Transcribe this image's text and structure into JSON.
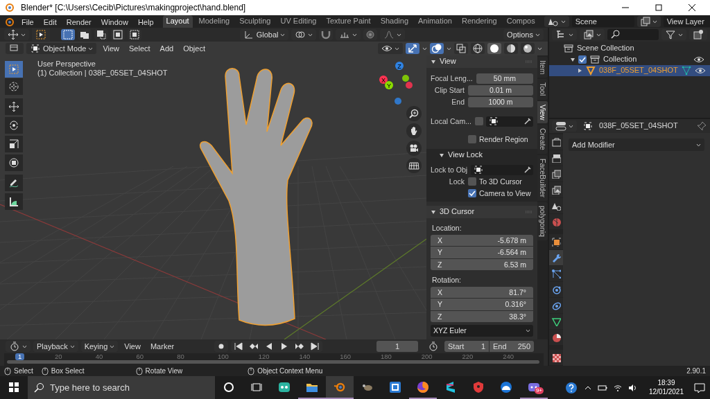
{
  "window": {
    "title": "Blender* [C:\\Users\\Cecib\\Pictures\\makingproject\\hand.blend]"
  },
  "menu": [
    "File",
    "Edit",
    "Render",
    "Window",
    "Help"
  ],
  "workspaces": [
    {
      "label": "Layout",
      "selected": true
    },
    {
      "label": "Modeling",
      "selected": false
    },
    {
      "label": "Sculpting",
      "selected": false
    },
    {
      "label": "UV Editing",
      "selected": false
    },
    {
      "label": "Texture Paint",
      "selected": false
    },
    {
      "label": "Shading",
      "selected": false
    },
    {
      "label": "Animation",
      "selected": false
    },
    {
      "label": "Rendering",
      "selected": false
    },
    {
      "label": "Compos",
      "selected": false
    }
  ],
  "scene": "Scene",
  "view_layer": "View Layer",
  "tool_header": {
    "orientation": "Global",
    "options": "Options",
    "snap": {
      "on": false
    },
    "proportional": {
      "on": false
    },
    "select_modes": [
      {
        "kind": "new",
        "selected": true
      },
      {
        "kind": "extend",
        "selected": false
      },
      {
        "kind": "subtract",
        "selected": false
      },
      {
        "kind": "invert",
        "selected": false
      },
      {
        "kind": "intersect",
        "selected": false
      }
    ]
  },
  "viewport_header": {
    "mode": "Object Mode",
    "menus": [
      "View",
      "Select",
      "Add",
      "Object"
    ],
    "toggles": [
      {
        "kind": "gizmo",
        "on": true
      },
      {
        "kind": "overlays",
        "on": true
      },
      {
        "kind": "xray",
        "on": false
      }
    ],
    "shading": [
      {
        "kind": "wireframe",
        "selected": false
      },
      {
        "kind": "solid",
        "selected": true
      },
      {
        "kind": "material",
        "selected": false
      },
      {
        "kind": "rendered",
        "selected": false
      }
    ]
  },
  "viewport": {
    "view_name": "User Perspective",
    "object_info": "(1) Collection | 038F_05SET_04SHOT",
    "gizmo": [
      {
        "label": "Z",
        "color": "#2f83e3"
      },
      {
        "label": "X",
        "color": "#ff3352"
      },
      {
        "label": "Y",
        "color": "#8bdc00"
      }
    ]
  },
  "tools": [
    {
      "kind": "select",
      "selected": true
    },
    {
      "kind": "cursor",
      "selected": false
    },
    {
      "kind": "move",
      "selected": false
    },
    {
      "kind": "rotate",
      "selected": false
    },
    {
      "kind": "scale",
      "selected": false
    },
    {
      "kind": "transform",
      "selected": false
    },
    {
      "kind": "annotate",
      "selected": false
    },
    {
      "kind": "measure",
      "selected": false
    }
  ],
  "sidebar_tabs": [
    {
      "label": "Item",
      "selected": false
    },
    {
      "label": "Tool",
      "selected": false
    },
    {
      "label": "View",
      "selected": true
    },
    {
      "label": "Create",
      "selected": false
    },
    {
      "label": "FaceBuilder",
      "selected": false
    },
    {
      "label": "polygoniq",
      "selected": false
    }
  ],
  "view_panel": {
    "title": "View",
    "expanded": true,
    "fields": [
      {
        "label": "Focal Leng...",
        "value": "50 mm"
      },
      {
        "label": "Clip Start",
        "value": "0.01 m"
      },
      {
        "label": "End",
        "value": "1000 m"
      }
    ],
    "local_camera": {
      "label": "Local Cam...",
      "checked": false
    },
    "render_region": {
      "label": "Render Region",
      "checked": false
    }
  },
  "view_lock": {
    "title": "View Lock",
    "expanded": true,
    "lock_to_object": "Lock to Obj",
    "lock_label": "Lock",
    "options": [
      {
        "label": "To 3D Cursor",
        "checked": false
      },
      {
        "label": "Camera to View",
        "checked": true
      }
    ]
  },
  "cursor_panel": {
    "title": "3D Cursor",
    "expanded": true,
    "location_label": "Location:",
    "location": [
      {
        "axis": "X",
        "value": "-5.678 m"
      },
      {
        "axis": "Y",
        "value": "-6.564 m"
      },
      {
        "axis": "Z",
        "value": "6.53 m"
      }
    ],
    "rotation_label": "Rotation:",
    "rotation": [
      {
        "axis": "X",
        "value": "81.7°"
      },
      {
        "axis": "Y",
        "value": "0.316°"
      },
      {
        "axis": "Z",
        "value": "38.3°"
      }
    ],
    "rotation_mode": "XYZ Euler"
  },
  "outliner": {
    "tree": [
      {
        "label": "Scene Collection",
        "kind": "scene",
        "selected": false,
        "children": [
          {
            "label": "Collection",
            "kind": "collection",
            "selected": false,
            "expanded": true,
            "checked": true,
            "visible": true,
            "children": [
              {
                "label": "038F_05SET_04SHOT",
                "kind": "mesh",
                "selected": true,
                "expanded": false,
                "visible": true
              }
            ]
          }
        ]
      }
    ]
  },
  "properties": {
    "object_name": "038F_05SET_04SHOT",
    "add_modifier": "Add Modifier",
    "tabs": [
      {
        "kind": "tool",
        "selected": false
      },
      {
        "kind": "render",
        "selected": false
      },
      {
        "kind": "output",
        "selected": false
      },
      {
        "kind": "view_layer",
        "selected": false
      },
      {
        "kind": "scene",
        "selected": false
      },
      {
        "kind": "world",
        "selected": false
      },
      {
        "kind": "object",
        "selected": false
      },
      {
        "kind": "modifiers",
        "selected": true
      },
      {
        "kind": "particles",
        "selected": false
      },
      {
        "kind": "physics",
        "selected": false
      },
      {
        "kind": "constraints",
        "selected": false
      },
      {
        "kind": "data",
        "selected": false
      },
      {
        "kind": "material",
        "selected": false
      },
      {
        "kind": "texture",
        "selected": false
      }
    ]
  },
  "timeline": {
    "menus": [
      "Playback",
      "Keying",
      "View",
      "Marker"
    ],
    "current_frame": "1",
    "start_label": "Start",
    "start": "1",
    "end_label": "End",
    "end": "250",
    "playhead": "1",
    "ruler": [
      "20",
      "40",
      "60",
      "80",
      "100",
      "120",
      "140",
      "160",
      "180",
      "200",
      "220",
      "240"
    ]
  },
  "status_bar": {
    "hints": [
      "Select",
      "Box Select",
      "Rotate View",
      "Object Context Menu"
    ],
    "version": "2.90.1"
  },
  "taskbar": {
    "search_placeholder": "Type here to search",
    "apps": [
      {
        "kind": "chat",
        "running": false
      },
      {
        "kind": "folder",
        "running": true
      },
      {
        "kind": "blender",
        "running": true
      },
      {
        "kind": "paint",
        "running": false
      },
      {
        "kind": "square",
        "running": false
      },
      {
        "kind": "browser",
        "running": true
      },
      {
        "kind": "letter",
        "running": false
      },
      {
        "kind": "shield",
        "running": false
      },
      {
        "kind": "dome",
        "running": false
      },
      {
        "kind": "discord",
        "running": true
      }
    ],
    "badge": "9+",
    "time": "18:39",
    "date": "12/01/2021"
  }
}
